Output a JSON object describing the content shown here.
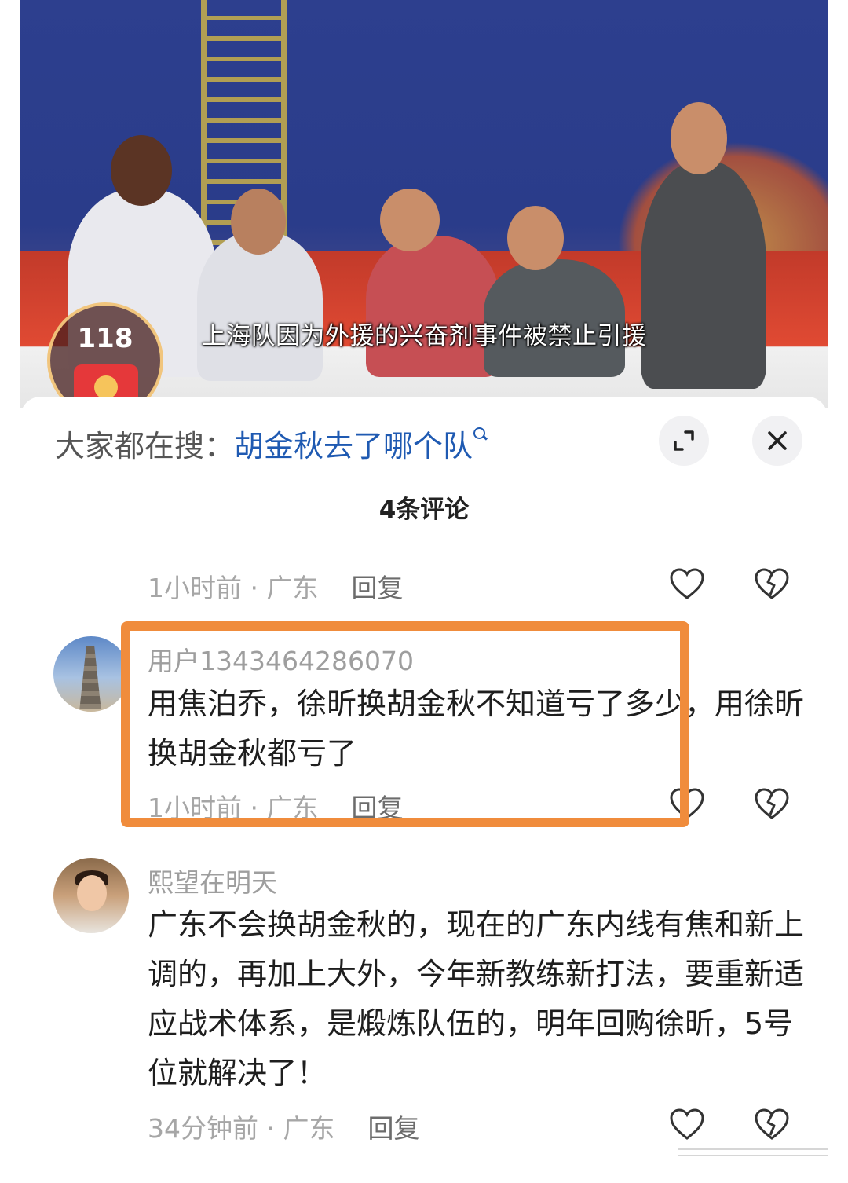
{
  "video": {
    "subtitle": "上海队因为外援的兴奋剂事件被禁止引援",
    "coin_count": "118"
  },
  "sheet": {
    "search_prefix": "大家都在搜：",
    "search_term": "胡金秋去了哪个队",
    "comment_count": "4条评论",
    "icons": {
      "expand": "expand-icon",
      "close": "close-icon",
      "like": "heart-icon",
      "dislike": "broken-heart-icon"
    }
  },
  "comments": [
    {
      "username": "",
      "text": "",
      "time": "1小时前",
      "location": "广东",
      "reply_label": "回复"
    },
    {
      "username": "用户1343464286070",
      "text": "用焦泊乔，徐昕换胡金秋不知道亏了多少，用徐昕换胡金秋都亏了",
      "time": "1小时前",
      "location": "广东",
      "reply_label": "回复"
    },
    {
      "username": "熙望在明天",
      "text": "广东不会换胡金秋的，现在的广东内线有焦和新上调的，再加上大外，今年新教练新打法，要重新适应战术体系，是煅炼队伍的，明年回购徐昕，5号位就解决了！",
      "time": "34分钟前",
      "location": "广东",
      "reply_label": "回复"
    }
  ],
  "colors": {
    "search_term": "#1f5ab2",
    "highlight_box": "#f08c3c",
    "meta_text": "#a6a6a6"
  }
}
